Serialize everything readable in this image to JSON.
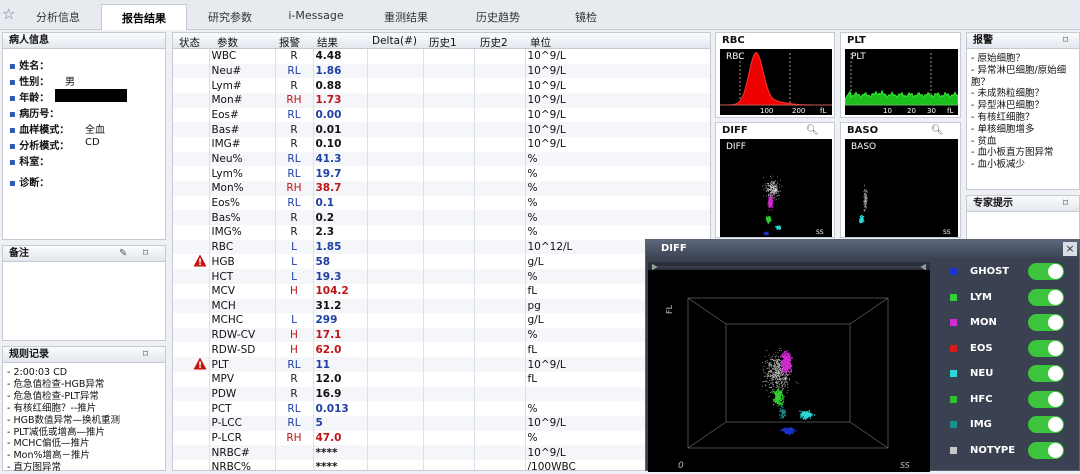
{
  "tabs": [
    "分析信息",
    "报告结果",
    "研究参数",
    "i-Message",
    "重测结果",
    "历史趋势",
    "镜检"
  ],
  "patient": {
    "title": "病人信息",
    "fields": [
      {
        "label": "姓名：",
        "value": ""
      },
      {
        "label": "性别：",
        "value": "男"
      },
      {
        "label": "年龄：",
        "value": ""
      },
      {
        "label": "病历号：",
        "value": ""
      },
      {
        "label": "血样模式：",
        "value": "全血"
      },
      {
        "label": "分析模式：",
        "value": "CD"
      },
      {
        "label": "科室：",
        "value": ""
      },
      {
        "label": "诊断：",
        "value": ""
      }
    ]
  },
  "notes": {
    "title": "备注"
  },
  "rules": {
    "title": "规则记录",
    "items": [
      "2:00:03 CD",
      "危急值检查-HGB异常",
      "危急值检查-PLT异常",
      "有核红细胞？--推片",
      "HGB数值异常—换机重测",
      "PLT减低或增高—推片",
      "MCHC偏低—推片",
      "Mon%增高－推片",
      "直方图异常"
    ]
  },
  "table": {
    "headers": [
      "状态",
      "参数",
      "报警",
      "结果",
      "Delta(#)",
      "历史1",
      "历史2",
      "单位"
    ],
    "rows": [
      {
        "status": "",
        "param": "WBC",
        "flag": "R",
        "result": "4.48",
        "unit": "10^9/L"
      },
      {
        "status": "",
        "param": "Neu#",
        "flag": "RL",
        "result": "1.86",
        "unit": "10^9/L"
      },
      {
        "status": "",
        "param": "Lym#",
        "flag": "R",
        "result": "0.88",
        "unit": "10^9/L"
      },
      {
        "status": "",
        "param": "Mon#",
        "flag": "RH",
        "result": "1.73",
        "unit": "10^9/L"
      },
      {
        "status": "",
        "param": "Eos#",
        "flag": "RL",
        "result": "0.00",
        "unit": "10^9/L"
      },
      {
        "status": "",
        "param": "Bas#",
        "flag": "R",
        "result": "0.01",
        "unit": "10^9/L"
      },
      {
        "status": "",
        "param": "IMG#",
        "flag": "R",
        "result": "0.10",
        "unit": "10^9/L"
      },
      {
        "status": "",
        "param": "Neu%",
        "flag": "RL",
        "result": "41.3",
        "unit": "%"
      },
      {
        "status": "",
        "param": "Lym%",
        "flag": "RL",
        "result": "19.7",
        "unit": "%"
      },
      {
        "status": "",
        "param": "Mon%",
        "flag": "RH",
        "result": "38.7",
        "unit": "%"
      },
      {
        "status": "",
        "param": "Eos%",
        "flag": "RL",
        "result": "0.1",
        "unit": "%"
      },
      {
        "status": "",
        "param": "Bas%",
        "flag": "R",
        "result": "0.2",
        "unit": "%"
      },
      {
        "status": "",
        "param": "IMG%",
        "flag": "R",
        "result": "2.3",
        "unit": "%"
      },
      {
        "status": "",
        "param": "RBC",
        "flag": "L",
        "result": "1.85",
        "unit": "10^12/L"
      },
      {
        "status": "!",
        "param": "HGB",
        "flag": "L",
        "result": "58",
        "unit": "g/L"
      },
      {
        "status": "",
        "param": "HCT",
        "flag": "L",
        "result": "19.3",
        "unit": "%"
      },
      {
        "status": "",
        "param": "MCV",
        "flag": "H",
        "result": "104.2",
        "unit": "fL"
      },
      {
        "status": "",
        "param": "MCH",
        "flag": "",
        "result": "31.2",
        "unit": "pg"
      },
      {
        "status": "",
        "param": "MCHC",
        "flag": "L",
        "result": "299",
        "unit": "g/L"
      },
      {
        "status": "",
        "param": "RDW-CV",
        "flag": "H",
        "result": "17.1",
        "unit": "%"
      },
      {
        "status": "",
        "param": "RDW-SD",
        "flag": "H",
        "result": "62.0",
        "unit": "fL"
      },
      {
        "status": "!",
        "param": "PLT",
        "flag": "RL",
        "result": "11",
        "unit": "10^9/L"
      },
      {
        "status": "",
        "param": "MPV",
        "flag": "R",
        "result": "12.0",
        "unit": "fL"
      },
      {
        "status": "",
        "param": "PDW",
        "flag": "R",
        "result": "16.9",
        "unit": ""
      },
      {
        "status": "",
        "param": "PCT",
        "flag": "RL",
        "result": "0.013",
        "unit": "%"
      },
      {
        "status": "",
        "param": "P-LCC",
        "flag": "RL",
        "result": "5",
        "unit": "10^9/L"
      },
      {
        "status": "",
        "param": "P-LCR",
        "flag": "RH",
        "result": "47.0",
        "unit": "%"
      },
      {
        "status": "",
        "param": "NRBC#",
        "flag": "",
        "result": "****",
        "unit": "10^9/L"
      },
      {
        "status": "",
        "param": "NRBC%",
        "flag": "",
        "result": "****",
        "unit": "/100WBC"
      }
    ]
  },
  "graphs": {
    "rbc": {
      "title": "RBC",
      "label": "RBC",
      "ticks": [
        "100",
        "200",
        "fL"
      ]
    },
    "plt": {
      "title": "PLT",
      "label": "PLT",
      "ticks": [
        "10",
        "20",
        "30",
        "fL"
      ]
    },
    "diff": {
      "title": "DIFF",
      "label": "DIFF",
      "axis": "SS"
    },
    "baso": {
      "title": "BASO",
      "label": "BASO",
      "axis": "SS"
    }
  },
  "alarms": {
    "title": "报警",
    "items": [
      "- 原始细胞？",
      "- 异常淋巴细胞/原始细",
      "胞？",
      "- 未成熟粒细胞？",
      "- 异型淋巴细胞？",
      "- 有核红细胞？",
      "- 单核细胞增多",
      "- 贫血",
      "- 血小板直方图异常",
      "- 血小板减少"
    ]
  },
  "expert": {
    "title": "专家提示"
  },
  "dialog": {
    "title": "DIFF",
    "close": "×",
    "axis_y": "FL",
    "axis_x": "SS",
    "origin": "0",
    "legend": [
      {
        "name": "GHOST",
        "color": "#1d33c8"
      },
      {
        "name": "LYM",
        "color": "#33d033"
      },
      {
        "name": "MON",
        "color": "#d32ad3"
      },
      {
        "name": "EOS",
        "color": "#d81b1b"
      },
      {
        "name": "NEU",
        "color": "#2bd8d8"
      },
      {
        "name": "HFC",
        "color": "#2fbf2f"
      },
      {
        "name": "IMG",
        "color": "#1e8f8f"
      },
      {
        "name": "NOTYPE",
        "color": "#c8c8c8"
      }
    ]
  }
}
